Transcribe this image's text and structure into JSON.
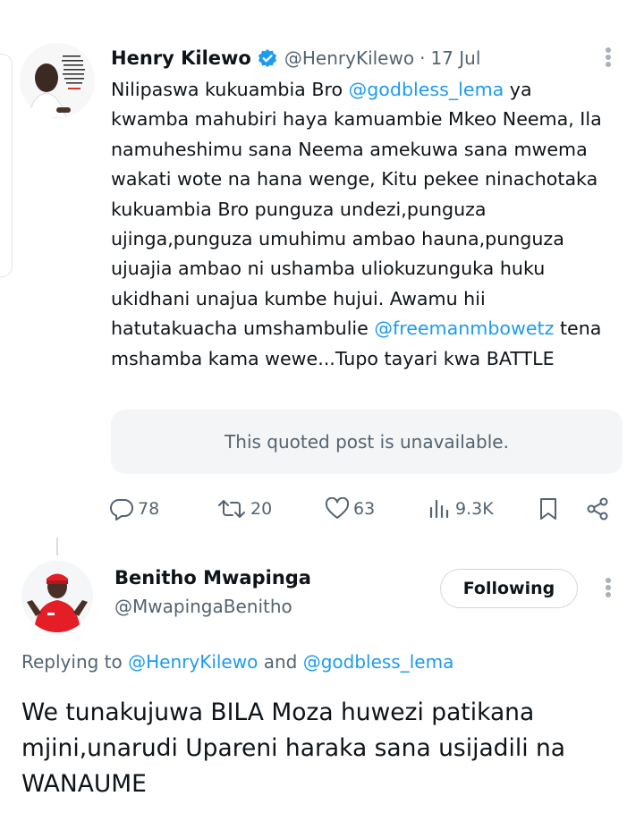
{
  "tweet": {
    "author_name": "Henry Kilewo",
    "author_handle": "@HenryKilewo",
    "separator": "·",
    "date": "17 Jul",
    "body_parts": [
      {
        "text": "Nilipaswa kukuambia Bro ",
        "mention": false
      },
      {
        "text": "@godbless_lema",
        "mention": true
      },
      {
        "text": " ya kwamba mahubiri haya kamuambie Mkeo Neema, Ila namuheshimu sana Neema amekuwa sana mwema wakati wote na hana wenge, Kitu pekee ninachotaka kukuambia Bro punguza undezi,punguza ujinga,punguza umuhimu ambao hauna,punguza ujuajia ambao ni ushamba uliokuzunguka huku ukidhani unajua kumbe hujui. Awamu hii hatutakuacha umshambulie ",
        "mention": false
      },
      {
        "text": "@freemanmbowetz",
        "mention": true
      },
      {
        "text": " tena mshamba kama wewe...Tupo tayari kwa BATTLE",
        "mention": false
      }
    ],
    "quoted_unavailable": "This quoted post is unavailable.",
    "actions": {
      "replies": "78",
      "reposts": "20",
      "likes": "63",
      "views": "9.3K"
    }
  },
  "reply": {
    "author_name": "Benitho Mwapinga",
    "author_handle": "@MwapingaBenitho",
    "follow_label": "Following",
    "replying_prefix": "Replying to",
    "replying_to_1": "@HenryKilewo",
    "replying_and": "and",
    "replying_to_2": "@godbless_lema",
    "text": "We tunakujuwa BILA Moza huwezi patikana mjini,unarudi Upareni haraka sana usijadili na WANAUME"
  },
  "icons": {
    "verified": "verified-badge-icon",
    "more": "more-options-icon",
    "reply": "reply-icon",
    "repost": "repost-icon",
    "like": "heart-icon",
    "views": "views-icon",
    "bookmark": "bookmark-icon",
    "share": "share-icon"
  },
  "colors": {
    "accent": "#1d9bf0",
    "text_primary": "#0f1419",
    "text_secondary": "#536471",
    "quote_bg": "#f3f5f7",
    "avatar_shirt_red": "#e41e26"
  }
}
